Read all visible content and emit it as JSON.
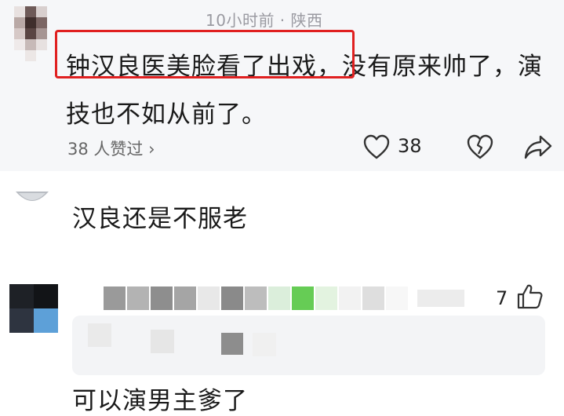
{
  "comments": [
    {
      "meta": "10小时前 · 陕西",
      "highlight": "钟汉良医美脸看了出戏，",
      "text_rest": "没有原来帅了，演技也不如从前了。",
      "liked_by": "38 人赞过 ›",
      "like_count": "38",
      "icons": {
        "like": "heart-outline-icon",
        "dislike": "broken-heart-icon",
        "share": "share-arrow-icon"
      }
    },
    {
      "text": "汉良还是不服老"
    },
    {
      "like_count": "7",
      "text": "可以演男主爹了",
      "icons": {
        "like": "thumbs-up-icon"
      }
    }
  ],
  "colors": {
    "highlight_border": "#e02020",
    "comment_bg": "#f6f7f9",
    "meta_text": "#9a9aa1",
    "reply_box_bg": "#f3f4f6"
  }
}
